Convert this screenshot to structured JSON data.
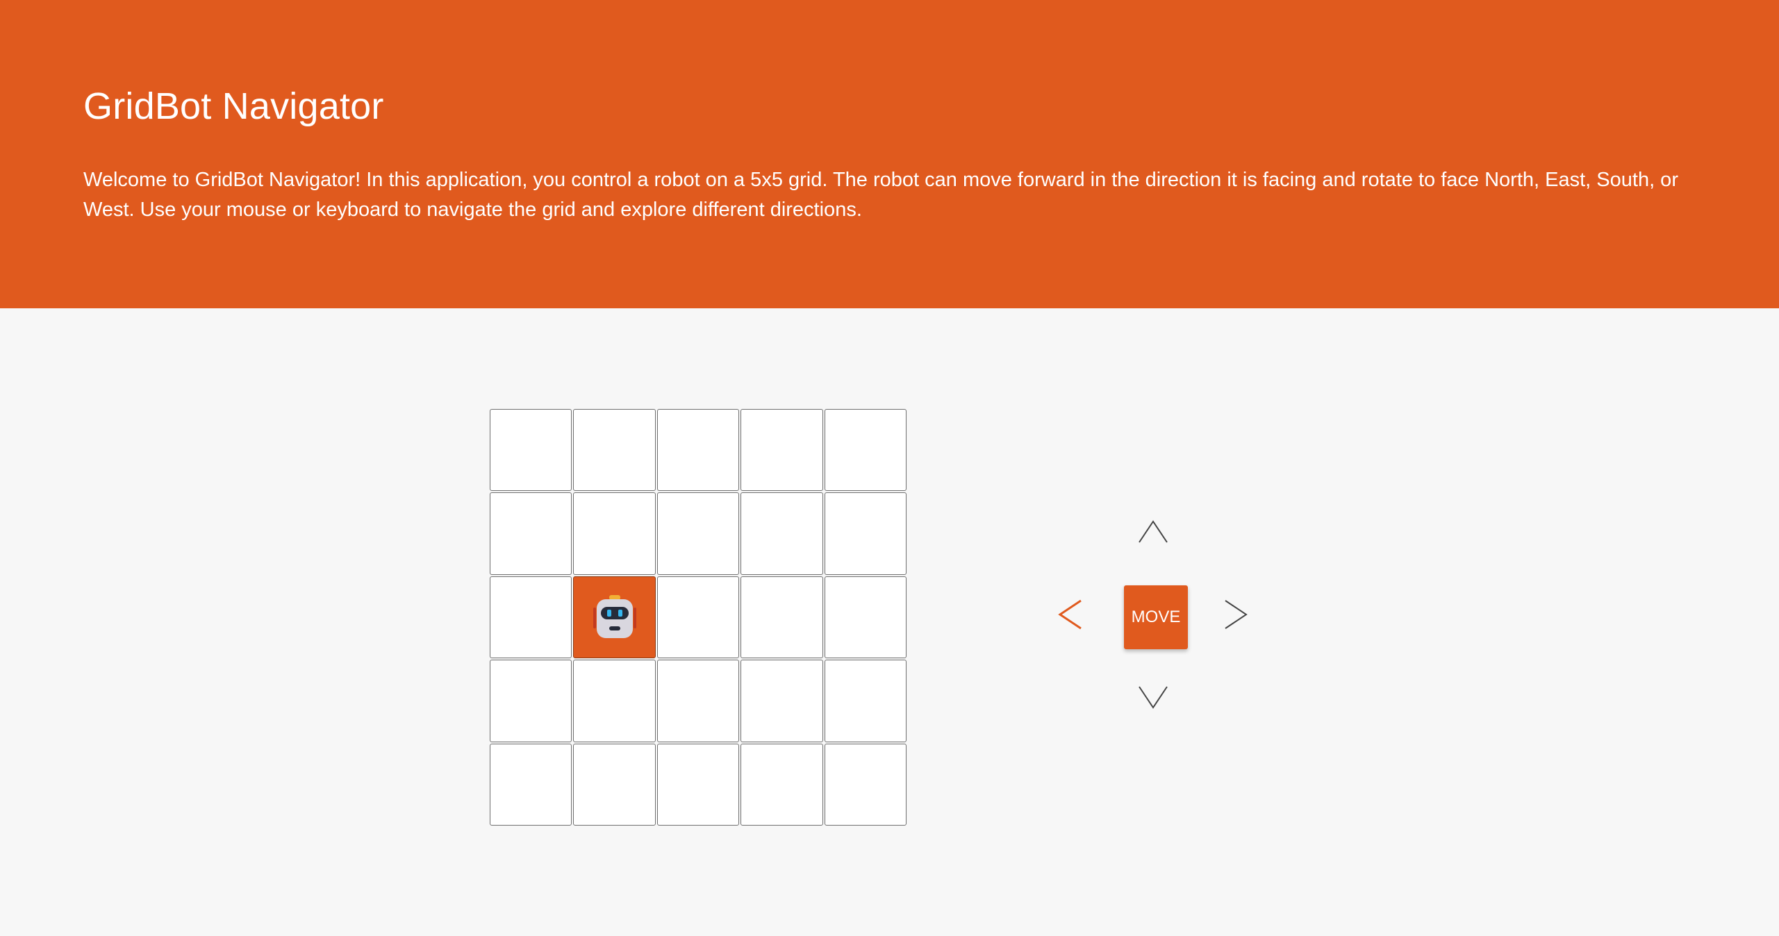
{
  "app": {
    "title": "GridBot Navigator",
    "description": "Welcome to GridBot Navigator! In this application, you control a robot on a 5x5 grid. The robot can move forward in the direction it is facing and rotate to face North, East, South, or West. Use your mouse or keyboard to navigate the grid and explore different directions."
  },
  "grid": {
    "rows": 5,
    "cols": 5,
    "robot_row": 2,
    "robot_col": 1
  },
  "controls": {
    "move_label": "MOVE",
    "selected_direction": "west",
    "arrows": [
      "north-icon",
      "east-icon",
      "south-icon",
      "west-icon"
    ]
  },
  "colors": {
    "accent": "#e05a1e",
    "background": "#f7f7f7",
    "cell": "#ffffff",
    "cell_border": "#6e6e6e",
    "arrow": "#444444"
  }
}
